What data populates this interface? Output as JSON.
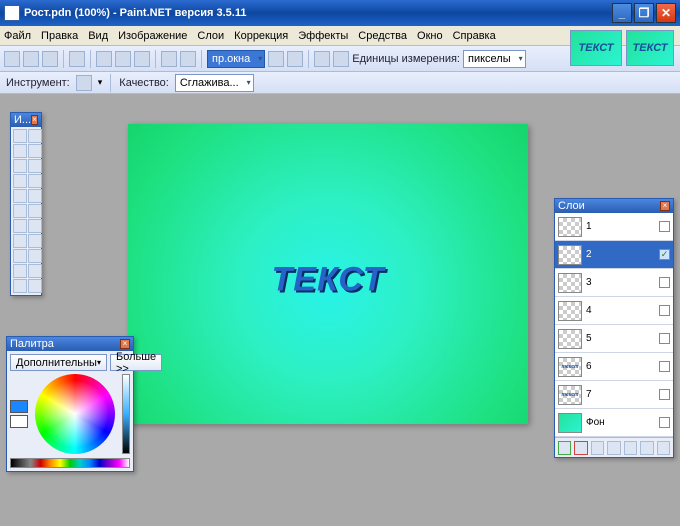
{
  "title": "Рост.pdn (100%) - Paint.NET версия 3.5.11",
  "menu": [
    "Файл",
    "Правка",
    "Вид",
    "Изображение",
    "Слои",
    "Коррекция",
    "Эффекты",
    "Средства",
    "Окно",
    "Справка"
  ],
  "toolbar": {
    "zoom": "пр.окна",
    "units_label": "Единицы измерения:",
    "units_value": "пикселы"
  },
  "toolbar2": {
    "instrument": "Инструмент:",
    "quality": "Качество:",
    "quality_value": "Сглажива..."
  },
  "canvas_text": "ТЕКСТ",
  "thumb_text": "ТЕКСТ",
  "tools_title": "И...",
  "palette": {
    "title": "Палитра",
    "mode": "Дополнительны",
    "more": "Больше >>"
  },
  "layers": {
    "title": "Слои",
    "items": [
      {
        "name": "1",
        "thumb": "",
        "checked": false,
        "sel": false
      },
      {
        "name": "2",
        "thumb": "",
        "checked": true,
        "sel": true
      },
      {
        "name": "3",
        "thumb": "",
        "checked": false,
        "sel": false
      },
      {
        "name": "4",
        "thumb": "",
        "checked": false,
        "sel": false
      },
      {
        "name": "5",
        "thumb": "",
        "checked": false,
        "sel": false
      },
      {
        "name": "6",
        "thumb": "текст",
        "checked": false,
        "sel": false
      },
      {
        "name": "7",
        "thumb": "текст",
        "checked": false,
        "sel": false
      },
      {
        "name": "Фон",
        "thumb": "bg",
        "checked": false,
        "sel": false
      }
    ]
  }
}
